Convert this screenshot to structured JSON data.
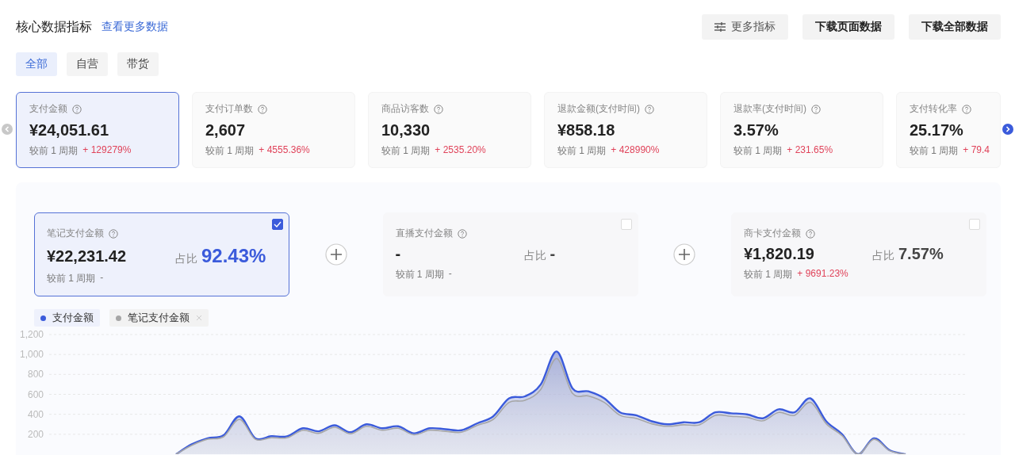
{
  "header": {
    "title": "核心数据指标",
    "link": "查看更多数据",
    "buttons": [
      {
        "label": "更多指标",
        "kind": "filter"
      },
      {
        "label": "下载页面数据",
        "kind": "plain"
      },
      {
        "label": "下载全部数据",
        "kind": "plain"
      }
    ]
  },
  "tabs": [
    {
      "label": "全部",
      "selected": true
    },
    {
      "label": "自营",
      "selected": false
    },
    {
      "label": "带货",
      "selected": false
    }
  ],
  "metrics": [
    {
      "name": "支付金额",
      "value": "¥24,051.61",
      "compare": "较前 1 周期",
      "change": "+ 129279%",
      "selected": true
    },
    {
      "name": "支付订单数",
      "value": "2,607",
      "compare": "较前 1 周期",
      "change": "+ 4555.36%",
      "selected": false
    },
    {
      "name": "商品访客数",
      "value": "10,330",
      "compare": "较前 1 周期",
      "change": "+ 2535.20%",
      "selected": false
    },
    {
      "name": "退款金额(支付时间)",
      "value": "¥858.18",
      "compare": "较前 1 周期",
      "change": "+ 428990%",
      "selected": false
    },
    {
      "name": "退款率(支付时间)",
      "value": "3.57%",
      "compare": "较前 1 周期",
      "change": "+ 231.65%",
      "selected": false
    },
    {
      "name": "支付转化率",
      "value": "25.17%",
      "compare": "较前 1 周期",
      "change": "+ 79.4",
      "selected": false
    }
  ],
  "breakdown": [
    {
      "name": "笔记支付金额",
      "value": "¥22,231.42",
      "share_label": "占比",
      "share": "92.43%",
      "compare": "较前 1 周期",
      "change": "-",
      "increase": false,
      "checked": true
    },
    {
      "name": "直播支付金额",
      "value": "-",
      "share_label": "占比",
      "share": "-",
      "compare": "较前 1 周期",
      "change": "-",
      "increase": false,
      "checked": false
    },
    {
      "name": "商卡支付金额",
      "value": "¥1,820.19",
      "share_label": "占比",
      "share": "7.57%",
      "compare": "较前 1 周期",
      "change": "+ 9691.23%",
      "increase": true,
      "checked": false
    }
  ],
  "legend": [
    {
      "removable": false
    },
    {
      "removable": true
    }
  ],
  "chart_data": {
    "type": "area",
    "grid": true,
    "yticks": [
      200,
      400,
      600,
      800,
      {
        "value": 1000,
        "label": "1,000"
      },
      {
        "value": 1200,
        "label": "1,200"
      }
    ],
    "ylim": [
      0,
      1200
    ],
    "series": [
      {
        "name": "支付金额",
        "color": "#3b5bdb",
        "values": [
          null,
          null,
          null,
          null,
          null,
          null,
          null,
          null,
          0,
          100,
          160,
          190,
          380,
          160,
          180,
          180,
          260,
          230,
          290,
          220,
          300,
          260,
          280,
          210,
          260,
          250,
          240,
          310,
          380,
          560,
          580,
          700,
          1030,
          660,
          630,
          560,
          420,
          390,
          330,
          300,
          320,
          320,
          420,
          410,
          400,
          360,
          450,
          420,
          560,
          330,
          200,
          0,
          160,
          40,
          0,
          null,
          null,
          null,
          null
        ]
      },
      {
        "name": "笔记支付金额",
        "color": "#a6a6a6",
        "values": [
          null,
          null,
          null,
          null,
          null,
          null,
          null,
          null,
          0,
          90,
          150,
          175,
          350,
          150,
          165,
          165,
          240,
          210,
          270,
          205,
          280,
          240,
          260,
          195,
          240,
          230,
          220,
          290,
          350,
          520,
          540,
          650,
          960,
          610,
          585,
          520,
          390,
          360,
          305,
          280,
          295,
          295,
          390,
          380,
          370,
          335,
          420,
          390,
          520,
          305,
          185,
          0,
          150,
          35,
          0,
          null,
          null,
          null,
          null
        ]
      }
    ]
  }
}
